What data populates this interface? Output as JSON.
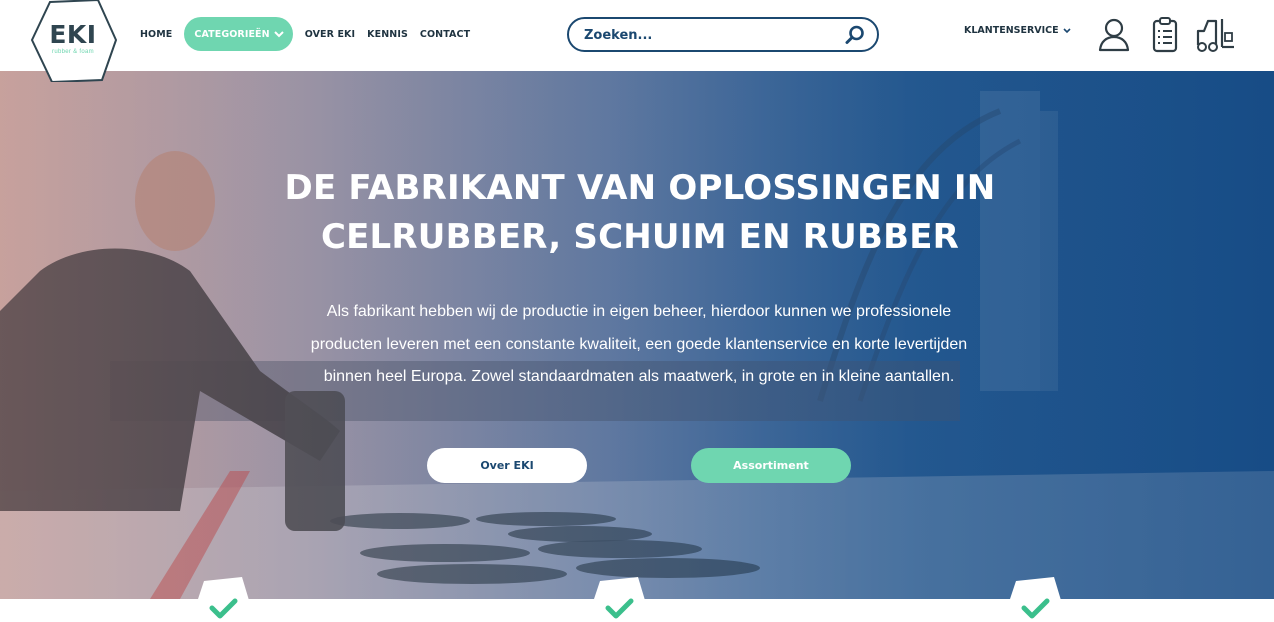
{
  "brand": {
    "logo_text": "EKI",
    "logo_sub": "rubber & foam",
    "accent": "#6fd6b0",
    "navy": "#1b4870"
  },
  "nav": {
    "items": [
      {
        "label": "HOME"
      },
      {
        "label": "CATEGORIEËN"
      },
      {
        "label": "OVER EKI"
      },
      {
        "label": "KENNIS"
      },
      {
        "label": "CONTACT"
      }
    ]
  },
  "search": {
    "placeholder": "Zoeken..."
  },
  "header_right": {
    "klantenservice": "KLANTENSERVICE",
    "icons": [
      "user-icon",
      "clipboard-list-icon",
      "forklift-icon"
    ]
  },
  "hero": {
    "title": "DE FABRIKANT VAN OPLOSSINGEN IN CELRUBBER, SCHUIM EN RUBBER",
    "text": "Als fabrikant hebben wij de productie in eigen beheer, hierdoor kunnen we professionele producten leveren met een constante kwaliteit, een goede klantenservice en korte levertijden binnen heel Europa. Zowel standaardmaten als maatwerk, in grote en in kleine aantallen.",
    "button_primary": "Over EKI",
    "button_secondary": "Assortiment"
  },
  "features": {
    "icons": [
      "check-icon",
      "check-icon",
      "check-icon"
    ]
  }
}
